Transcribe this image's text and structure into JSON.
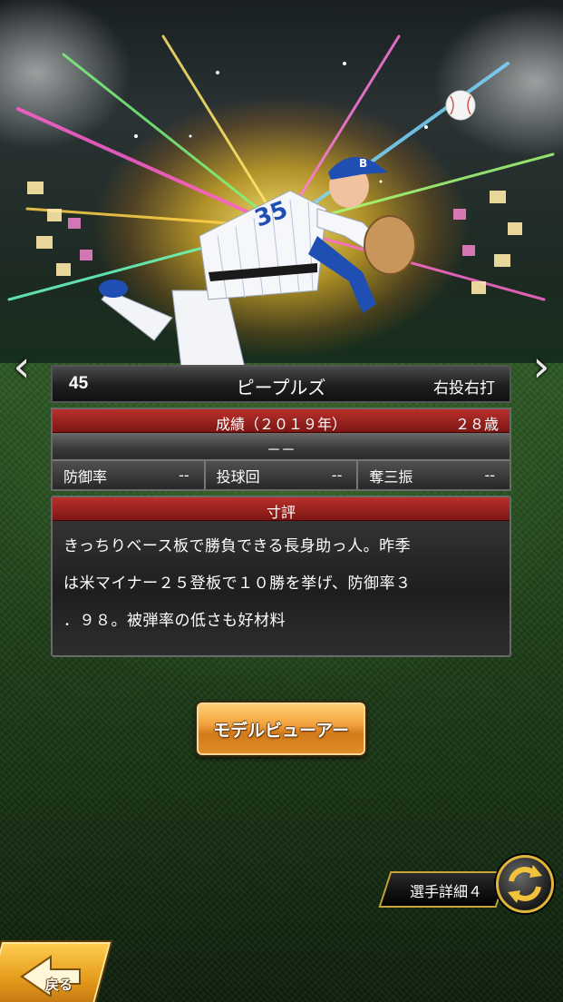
{
  "player": {
    "number": "45",
    "name": "ピープルズ",
    "handedness": "右投右打"
  },
  "stats": {
    "header": "成績（２０１９年）",
    "age": "２８歳",
    "team_line": "－－",
    "era_label": "防御率",
    "era_value": "--",
    "innings_label": "投球回",
    "innings_value": "--",
    "strikeouts_label": "奪三振",
    "strikeouts_value": "--"
  },
  "review": {
    "header": "寸評",
    "lines": [
      "きっちりベース板で勝負できる長身助っ人。昨季",
      "は米マイナー２５登板で１０勝を挙げ、防御率３",
      "．９８。被弾率の低さも好材料"
    ]
  },
  "buttons": {
    "model_viewer": "モデルビューアー",
    "player_detail": "選手詳細４",
    "back": "戻る"
  },
  "icons": {
    "prev": "chevron-left-icon",
    "next": "chevron-right-icon",
    "swap": "swap-arrows-icon",
    "back": "back-arrow-icon",
    "ball": "baseball-icon"
  },
  "colors": {
    "accent_red": "#b9302a",
    "button_orange": "#f3a540",
    "gold_border": "#e0b53a"
  }
}
